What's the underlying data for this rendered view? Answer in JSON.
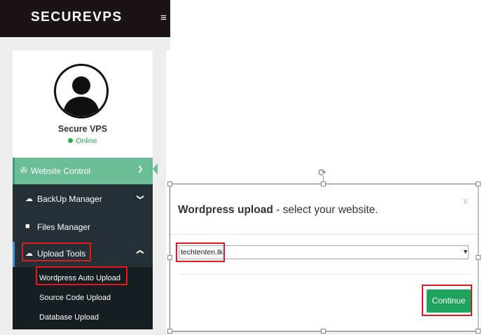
{
  "brand": {
    "name": "SECUREVPS",
    "menu_icon": "hamburger-icon"
  },
  "profile": {
    "name": "Secure VPS",
    "status": "Online",
    "status_color": "#22b14c"
  },
  "sidebar": {
    "website_control": "Website Control",
    "backup_manager": "BackUp Manager",
    "files_manager": "Files Manager",
    "upload_tools": "Upload Tools",
    "sub_items": [
      "Wordpress Auto Upload",
      "Source Code Upload",
      "Database Upload"
    ]
  },
  "modal": {
    "title_bold": "Wordpress upload",
    "title_rest": " - select your website.",
    "close": "x",
    "selected_website": "techtenten.tk",
    "continue_label": "Continue"
  },
  "colors": {
    "accent_green": "#6bbd98",
    "button_green": "#1ea35c",
    "highlight_red": "#e0191e",
    "sidebar_dark": "#243035"
  }
}
